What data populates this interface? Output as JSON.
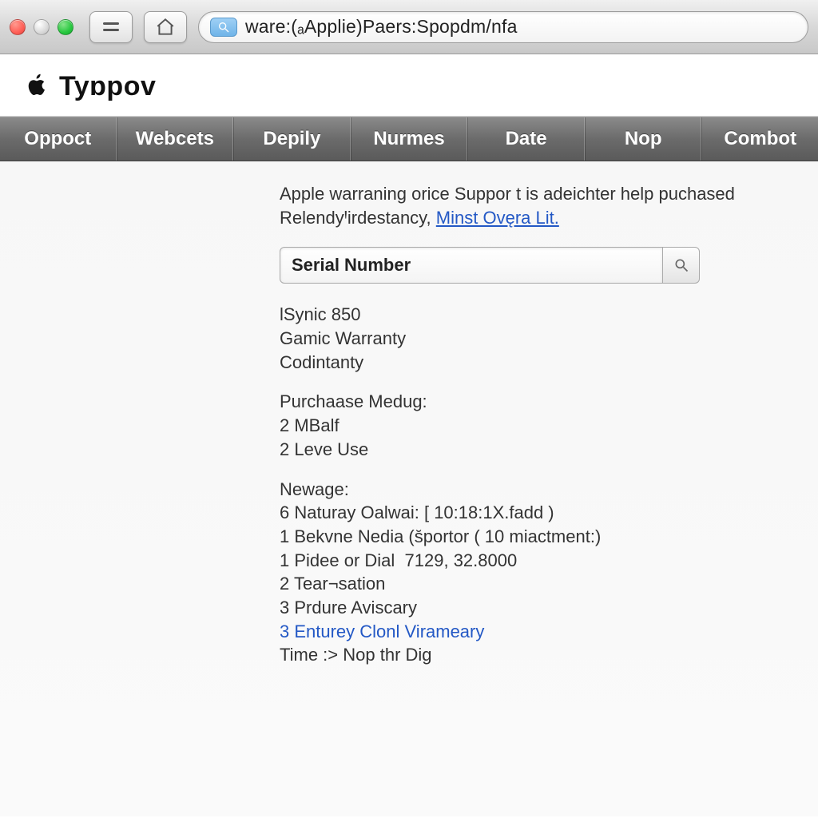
{
  "toolbar": {
    "address_text": "ware:(ₐApplie)Paers:Spopdm/nfa"
  },
  "header": {
    "title": "Tyɒpov"
  },
  "nav": {
    "items": [
      {
        "label": "Oppoct"
      },
      {
        "label": "Webcets"
      },
      {
        "label": "Depily"
      },
      {
        "label": "Nurmes"
      },
      {
        "label": "Date"
      },
      {
        "label": "Nop"
      },
      {
        "label": "Combot"
      }
    ]
  },
  "intro": {
    "text_a": "Apple warraning orice Suppor t is adeichter help puchased RelendyꞋirdestancy,",
    "link": "Minst Ovęra Lit."
  },
  "serial": {
    "placeholder": "Serial Number"
  },
  "body": {
    "group1": [
      "lSynic 850",
      "Gamic Warranty",
      "Codintanty"
    ],
    "group2_header": "Purchaase Medug:",
    "group2": [
      "2 MBalf",
      "2 Leve Use"
    ],
    "group3_header": "Newage:",
    "group3": [
      "6 Naturay Oalwai: [ 10:18:1X.fadd )",
      "1 Bekvne Nedia (s̆portor ( 10 miactment:)",
      "1 Pidee or Dial  7129, 32.8000",
      "2 Tear¬sation",
      "3 Prdure Aviscary"
    ],
    "group3_link": "3 Enturey Clonl Virameary",
    "group3_final": "Time :> Nop thr Dig"
  }
}
